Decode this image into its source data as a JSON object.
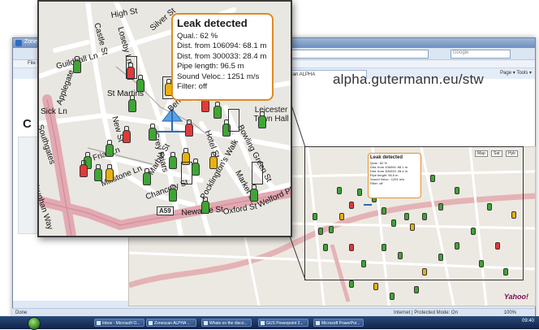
{
  "browser": {
    "window_title": "Zonescan ALPHA",
    "search_placeholder": "Google",
    "menu": "File  Edit  View  Favorites  Tools  Help",
    "tab_label": "Zonescan ALPHA",
    "command_bar": "Page ▾   Tools ▾",
    "site_url": "alpha.gutermann.eu/stw",
    "page_fragment": "C",
    "status_left": "Done",
    "status_zone": "Internet | Protected Mode: On",
    "status_zoom": "100%"
  },
  "small_map": {
    "map_types": [
      "Map",
      "Sat",
      "Hyb"
    ],
    "brand": "Yahoo!",
    "callout": {
      "title": "Leak detected",
      "lines": [
        "Qual.: 62 %",
        "Dist. from 106094: 68.1 m",
        "Dist. from 300033: 28.4 m",
        "Pipe length: 96.5 m",
        "Sound Veloc.: 1251 m/s",
        "Filter: off"
      ]
    }
  },
  "taskbar": {
    "tasks": [
      "Inbox - Microsoft O...",
      "Zonescan ALPHA ...",
      "Whats on the disco...",
      "GUS Powerpoint 2...",
      "Microsoft PowerPoi..."
    ],
    "clock": "09:40"
  },
  "inset": {
    "callout": {
      "title": "Leak detected",
      "lines": [
        "Qual.: 62 %",
        "Dist. from 106094: 68.1 m",
        "Dist. from 300033: 28.4 m",
        "Pipe length: 96.5 m",
        "Sound Veloc.: 1251 m/s",
        "Filter: off"
      ]
    },
    "road_sign": "A59",
    "streets": [
      "High St",
      "Guildhall Ln",
      "Applegate",
      "Castle St",
      "Loseby Ln",
      "Silver St",
      "Millstone Ln",
      "Newarke St",
      "Friar Ln",
      "New St",
      "Southgates",
      "Vaughan Way",
      "Grey Friars",
      "Berridge St",
      "Oxford St",
      "Marble St",
      "Bowling Green St",
      "Market St",
      "Welford Pl",
      "Hotel St",
      "Pocklington's Walk",
      "St Martins",
      "Chancery St",
      "Sick Ln"
    ],
    "poi": "Leicester Town Hall",
    "logger_colors": {
      "green": "#3fa535",
      "red": "#e13a3a",
      "yellow": "#e8b10e"
    }
  }
}
